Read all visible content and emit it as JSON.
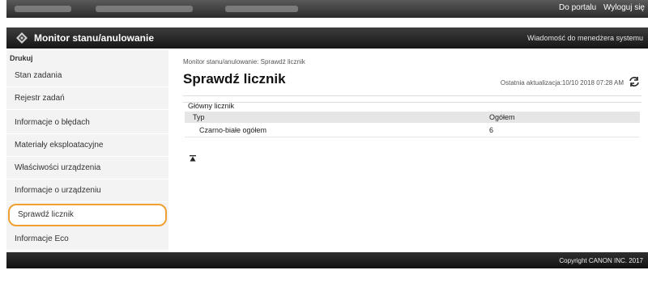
{
  "topbar": {
    "portal_label": "Do portalu",
    "logout_label": "Wyloguj się"
  },
  "header": {
    "app_title": "Monitor stanu/anulowanie",
    "admin_msg_label": "Wiadomość do menedżera systemu"
  },
  "sidebar": {
    "section": "Drukuj",
    "items": [
      {
        "label": "Stan zadania"
      },
      {
        "label": "Rejestr zadań"
      },
      {
        "label": "Informacje o błędach"
      },
      {
        "label": "Materiały eksploatacyjne"
      },
      {
        "label": "Właściwości urządzenia"
      },
      {
        "label": "Informacje o urządzeniu"
      },
      {
        "label": "Sprawdź licznik"
      },
      {
        "label": "Informacje Eco"
      }
    ]
  },
  "main": {
    "breadcrumb": "Monitor stanu/anulowanie: Sprawdź licznik",
    "page_title": "Sprawdź licznik",
    "last_update": "Ostatnia aktualizacja:10/10 2018 07:28 AM",
    "counter_section_title": "Główny licznik",
    "table": {
      "headers": [
        "Typ",
        "Ogółem"
      ],
      "rows": [
        [
          "Czarno-białe ogółem",
          "6"
        ]
      ]
    }
  },
  "footer": {
    "copyright": "Copyright CANON INC. 2017"
  },
  "colors": {
    "highlight_outline": "#f0a030",
    "bar_dark": "#2b2b2b",
    "sidebar_bg": "#f3f3f3"
  }
}
